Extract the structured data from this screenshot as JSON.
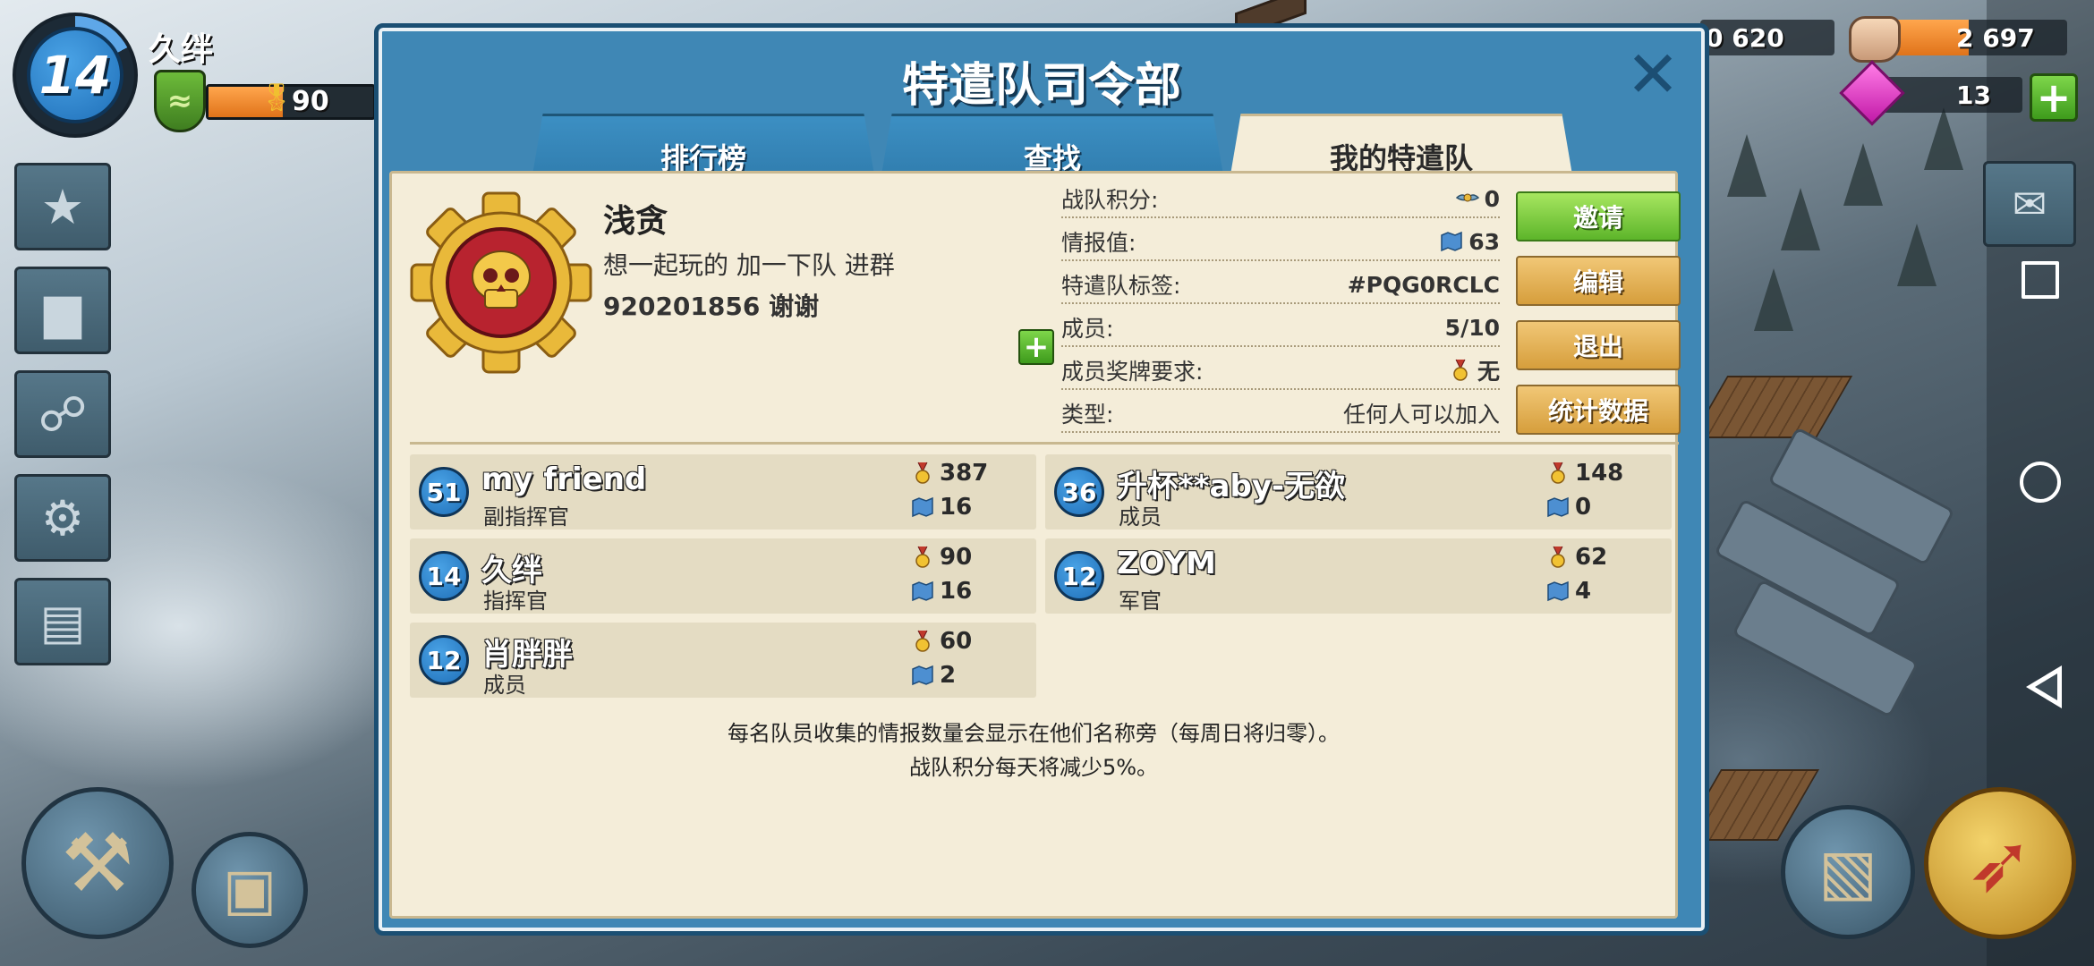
{
  "hud": {
    "player_level": "14",
    "player_name": "久绊",
    "medals": "90",
    "resource1": "0 620",
    "stone": "2 697",
    "diamonds": "13"
  },
  "dialog": {
    "title": "特遣队司令部",
    "tabs": [
      {
        "label": "排行榜",
        "active": false
      },
      {
        "label": "查找",
        "active": false
      },
      {
        "label": "我的特遣队",
        "active": true
      }
    ],
    "team": {
      "name": "浅贪",
      "description_line1": "想一起玩的 加一下队 进群",
      "description_line2": "920201856  谢谢"
    },
    "info": [
      {
        "label": "战队积分:",
        "value": "0",
        "icon": "wings-icon"
      },
      {
        "label": "情报值:",
        "value": "63",
        "icon": "intel-map-icon"
      },
      {
        "label": "特遣队标签:",
        "value": "#PQG0RCLC",
        "icon": ""
      },
      {
        "label": "成员:",
        "value": "5/10",
        "icon": ""
      },
      {
        "label": "成员奖牌要求:",
        "value": "无",
        "icon": "medal-icon"
      },
      {
        "label": "类型:",
        "value": "任何人可以加入",
        "icon": ""
      }
    ],
    "buttons": {
      "invite": "邀请",
      "edit": "编辑",
      "leave": "退出",
      "stats": "统计数据"
    },
    "members": [
      {
        "level": "51",
        "name": "my friend",
        "role": "副指挥官",
        "medals": "387",
        "intel": "16"
      },
      {
        "level": "36",
        "name": "升杯**aby-无欲",
        "role": "成员",
        "medals": "148",
        "intel": "0"
      },
      {
        "level": "14",
        "name": "久绊",
        "role": "指挥官",
        "medals": "90",
        "intel": "16"
      },
      {
        "level": "12",
        "name": "ZOYM",
        "role": "军官",
        "medals": "62",
        "intel": "4"
      },
      {
        "level": "12",
        "name": "肖胖胖",
        "role": "成员",
        "medals": "60",
        "intel": "2"
      }
    ],
    "footer_line1": "每名队员收集的情报数量会显示在他们名称旁（每周日将归零）。",
    "footer_line2": "战队积分每天将减少5%。"
  },
  "colors": {
    "dialog_blue": "#3f87b5",
    "parchment": "#f4edd9",
    "invite_green": "#7ed64a",
    "button_gold": "#e2b058"
  }
}
